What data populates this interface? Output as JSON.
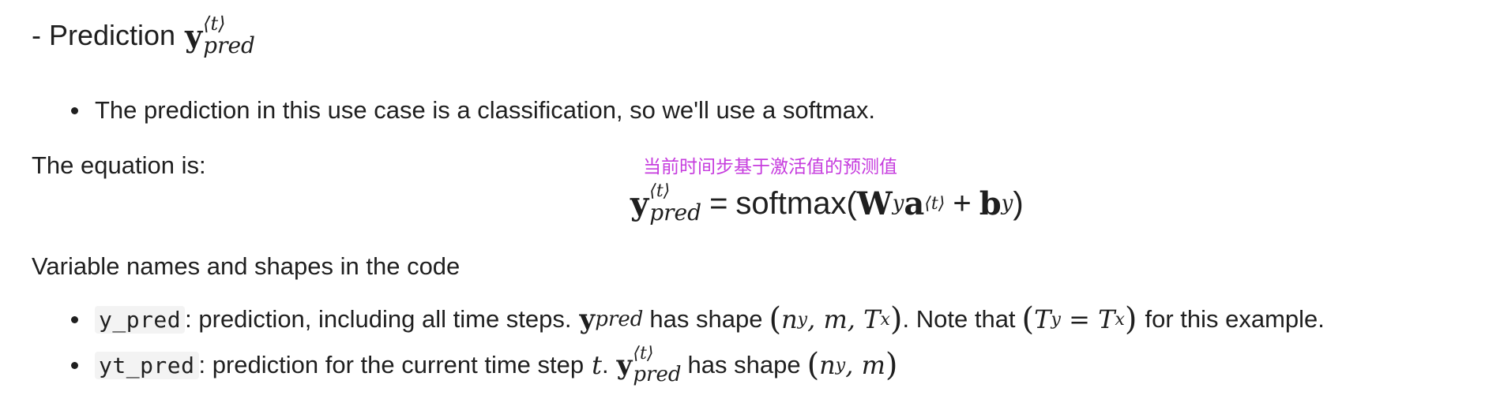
{
  "heading": {
    "prefix": "- Prediction",
    "symbol": "y",
    "superscript": "⟨t⟩",
    "subscript": "pred"
  },
  "bullet1": {
    "text": "The prediction in this use case is a classification, so we'll use a softmax."
  },
  "equation_intro": "The equation is:",
  "annotation": "当前时间步基于激活值的预测值",
  "equation": {
    "lhs_symbol": "y",
    "lhs_superscript": "⟨t⟩",
    "lhs_subscript": "pred",
    "equals": "=",
    "function": "softmax(",
    "weight": "W",
    "weight_sub": "y",
    "activation": "a",
    "activation_sup": "⟨t⟩",
    "plus": "+",
    "bias": "b",
    "bias_sub": "y",
    "close": ")"
  },
  "variables_heading": "Variable names and shapes in the code",
  "variables": [
    {
      "code": "y_pred",
      "text": ": prediction, including all time steps.",
      "symbol": "y",
      "symbol_sub": "pred",
      "shape_text": "has shape",
      "shape_open": "(",
      "shape_inner": "n",
      "shape_inner_sub": "y",
      "shape_rest": ", m, T",
      "shape_rest_sub": "x",
      "shape_close": ")",
      "note_prefix": ". Note that",
      "note_open": "(",
      "note_lhs": "T",
      "note_lhs_sub": "y",
      "note_eq": " = ",
      "note_rhs": "T",
      "note_rhs_sub": "x",
      "note_close": ")",
      "note_suffix": "for this example."
    },
    {
      "code": "yt_pred",
      "text": ": prediction for the current time step",
      "t_symbol": "t",
      "period": ".",
      "symbol": "y",
      "symbol_sup": "⟨t⟩",
      "symbol_sub": "pred",
      "shape_text": "has shape",
      "shape_open": "(",
      "shape_inner": "n",
      "shape_inner_sub": "y",
      "shape_rest": ", m",
      "shape_close": ")"
    }
  ]
}
